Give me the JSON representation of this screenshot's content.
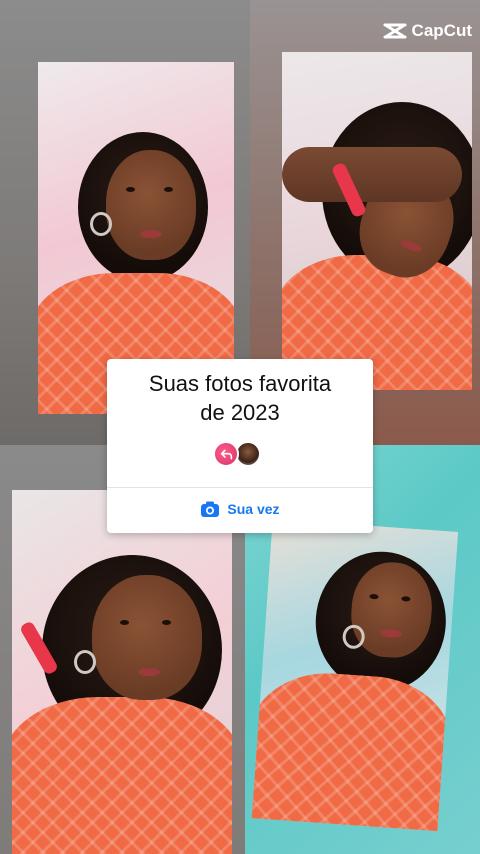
{
  "watermark": {
    "brand": "CapCut",
    "icon": "capcut-logo-icon"
  },
  "card": {
    "title_line1": "Suas fotos favorita",
    "title_line2": "de 2023",
    "action_label": "Sua vez",
    "action_icon": "camera-icon",
    "reply_icon": "reply-arrow-icon",
    "accent_color": "#1877f2",
    "reply_color": "#e8407a"
  },
  "photos": [
    {
      "name": "photo-1"
    },
    {
      "name": "photo-2"
    },
    {
      "name": "photo-3"
    },
    {
      "name": "photo-4"
    }
  ]
}
